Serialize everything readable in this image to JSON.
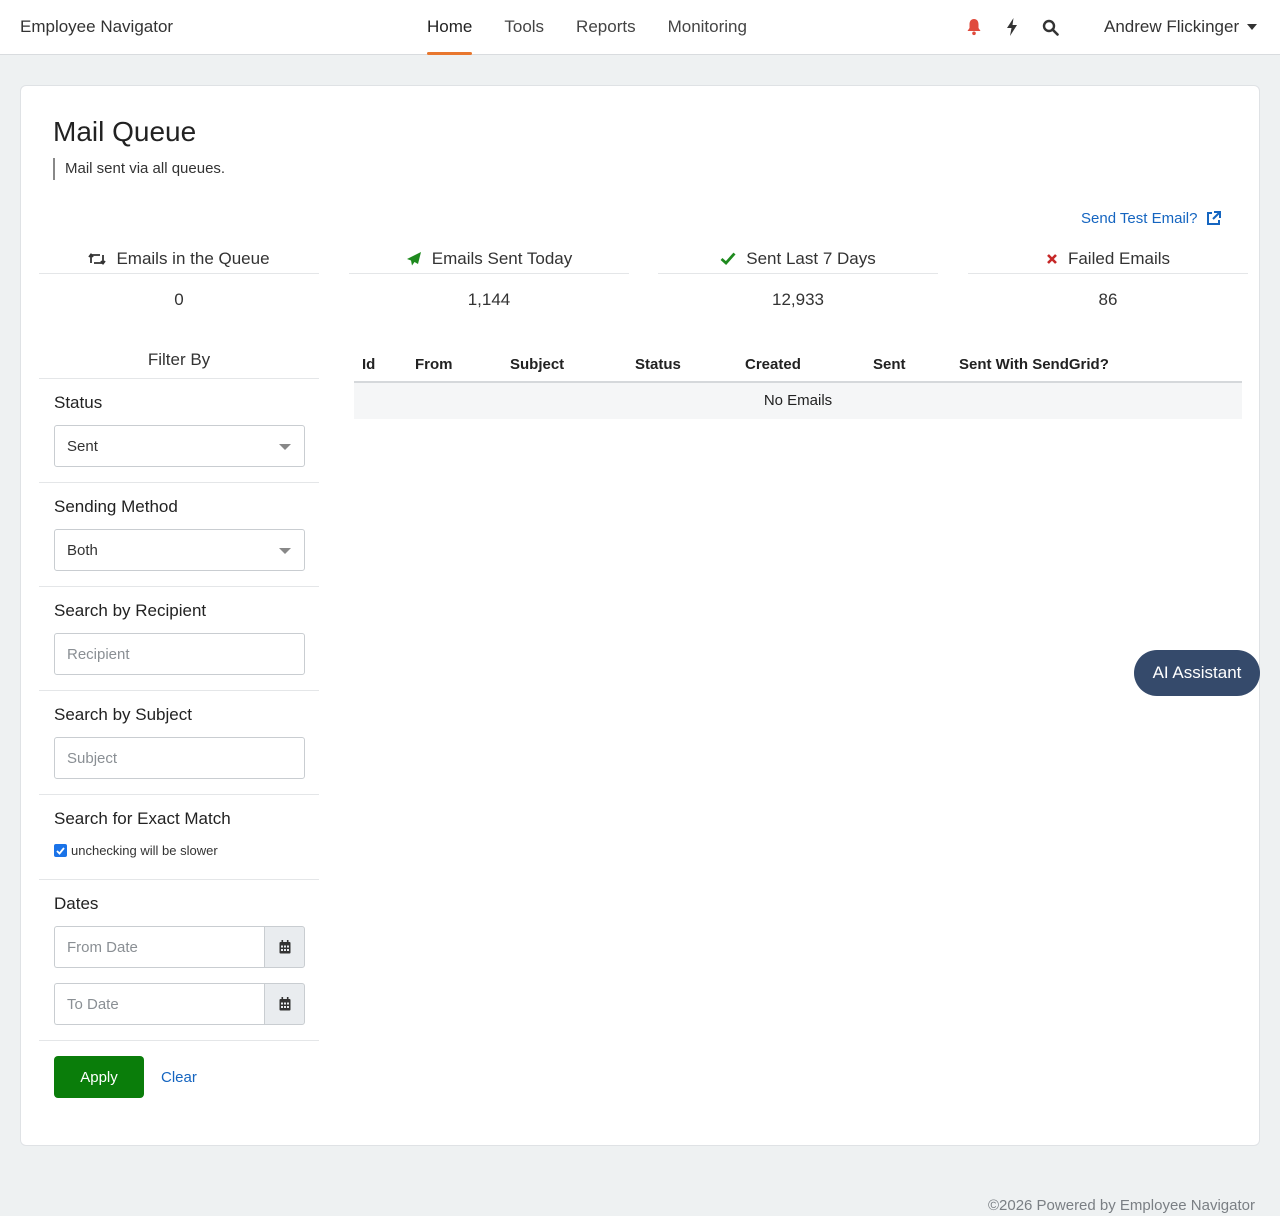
{
  "app": {
    "brand": "Employee Navigator"
  },
  "nav": {
    "items": [
      {
        "label": "Home",
        "active": true
      },
      {
        "label": "Tools",
        "active": false
      },
      {
        "label": "Reports",
        "active": false
      },
      {
        "label": "Monitoring",
        "active": false
      }
    ],
    "icons": [
      "bell-icon",
      "bolt-icon",
      "search-icon"
    ],
    "user": "Andrew Flickinger"
  },
  "page": {
    "title": "Mail Queue",
    "subtitle": "Mail sent via all queues.",
    "test_link": "Send Test Email?"
  },
  "stats": [
    {
      "label": "Emails in the Queue",
      "value": "0",
      "icon": "retweet-icon"
    },
    {
      "label": "Emails Sent Today",
      "value": "1,144",
      "icon": "paper-plane-icon"
    },
    {
      "label": "Sent Last 7 Days",
      "value": "12,933",
      "icon": "check-icon"
    },
    {
      "label": "Failed Emails",
      "value": "86",
      "icon": "x-icon"
    }
  ],
  "filter": {
    "title": "Filter By",
    "status": {
      "label": "Status",
      "value": "Sent"
    },
    "method": {
      "label": "Sending Method",
      "value": "Both"
    },
    "recipient": {
      "label": "Search by Recipient",
      "placeholder": "Recipient"
    },
    "subject": {
      "label": "Search by Subject",
      "placeholder": "Subject"
    },
    "exact": {
      "label": "Search for Exact Match",
      "checkbox_label": "unchecking will be slower",
      "checked": true
    },
    "dates": {
      "label": "Dates",
      "from_placeholder": "From Date",
      "to_placeholder": "To Date"
    },
    "apply": "Apply",
    "clear": "Clear"
  },
  "table": {
    "columns": [
      "Id",
      "From",
      "Subject",
      "Status",
      "Created",
      "Sent",
      "Sent With SendGrid?"
    ],
    "empty": "No Emails"
  },
  "ai_button": "AI Assistant",
  "footer": "©2026 Powered by Employee Navigator",
  "colors": {
    "accent": "#e8772e",
    "link": "#1565c0",
    "apply": "#0a7d0a",
    "success": "#1e8a1e",
    "danger": "#c62828",
    "ai": "#354a6b"
  }
}
